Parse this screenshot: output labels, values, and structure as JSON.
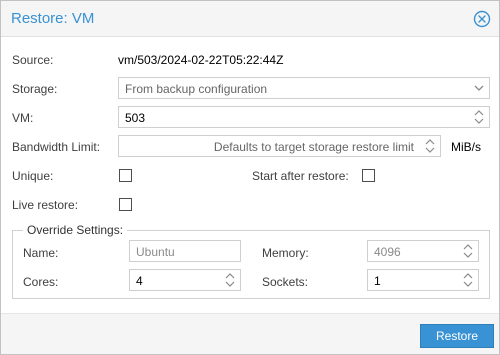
{
  "dialog": {
    "title": "Restore: VM",
    "close_icon": "close-circle-icon"
  },
  "form": {
    "source_label": "Source:",
    "source_value": "vm/503/2024-02-22T05:22:44Z",
    "storage_label": "Storage:",
    "storage_value": "From backup configuration",
    "vm_label": "VM:",
    "vm_value": "503",
    "bandwidth_label": "Bandwidth Limit:",
    "bandwidth_placeholder": "Defaults to target storage restore limit",
    "bandwidth_unit": "MiB/s",
    "unique_label": "Unique:",
    "unique_checked": false,
    "start_after_label": "Start after restore:",
    "start_after_checked": false,
    "live_restore_label": "Live restore:",
    "live_restore_checked": false
  },
  "override": {
    "legend": "Override Settings:",
    "name_label": "Name:",
    "name_placeholder": "Ubuntu",
    "memory_label": "Memory:",
    "memory_placeholder": "4096",
    "cores_label": "Cores:",
    "cores_value": "4",
    "sockets_label": "Sockets:",
    "sockets_value": "1"
  },
  "footer": {
    "restore_label": "Restore"
  },
  "colors": {
    "accent": "#3892d4",
    "header_bg": "#f5f5f5"
  }
}
